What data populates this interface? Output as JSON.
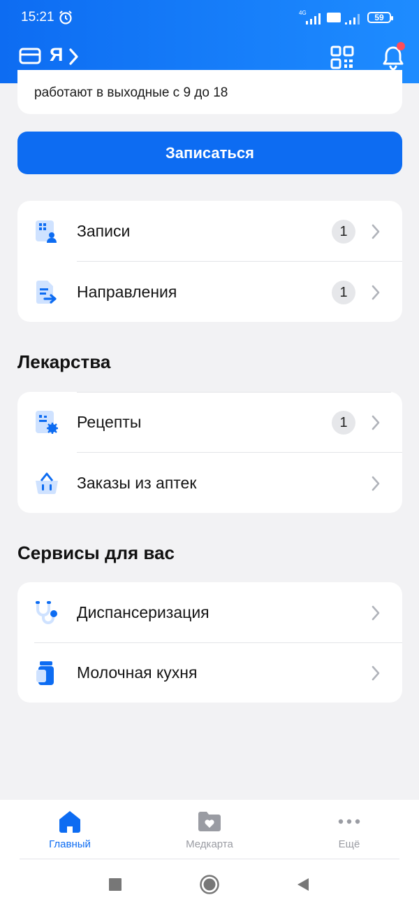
{
  "status_bar": {
    "time": "15:21",
    "battery": "59",
    "network_label": "4G",
    "volte_label": "Vo LTE"
  },
  "header": {
    "profile_name": "Я"
  },
  "info": {
    "text": "работают в выходные с 9 до 18"
  },
  "book_button": {
    "label": "Записаться"
  },
  "main_list": [
    {
      "label": "Записи",
      "badge": "1",
      "icon": "appointments-icon"
    },
    {
      "label": "Направления",
      "badge": "1",
      "icon": "referrals-icon"
    }
  ],
  "medicines": {
    "title": "Лекарства",
    "items": [
      {
        "label": "Рецепты",
        "badge": "1",
        "icon": "prescription-icon"
      },
      {
        "label": "Заказы из аптек",
        "icon": "pharmacy-basket-icon"
      }
    ]
  },
  "services": {
    "title": "Сервисы для вас",
    "items": [
      {
        "label": "Диспансеризация",
        "icon": "stethoscope-icon"
      },
      {
        "label": "Молочная кухня",
        "icon": "milk-icon"
      }
    ]
  },
  "tabbar": {
    "tabs": [
      {
        "label": "Главный",
        "active": true,
        "icon": "home-icon"
      },
      {
        "label": "Медкарта",
        "active": false,
        "icon": "medcard-icon"
      },
      {
        "label": "Ещё",
        "active": false,
        "icon": "more-icon"
      }
    ]
  },
  "colors": {
    "accent": "#0d6cf2",
    "background": "#f2f2f4",
    "notification_dot": "#ff4d5a",
    "inactive_tab": "#9a9ca3"
  }
}
